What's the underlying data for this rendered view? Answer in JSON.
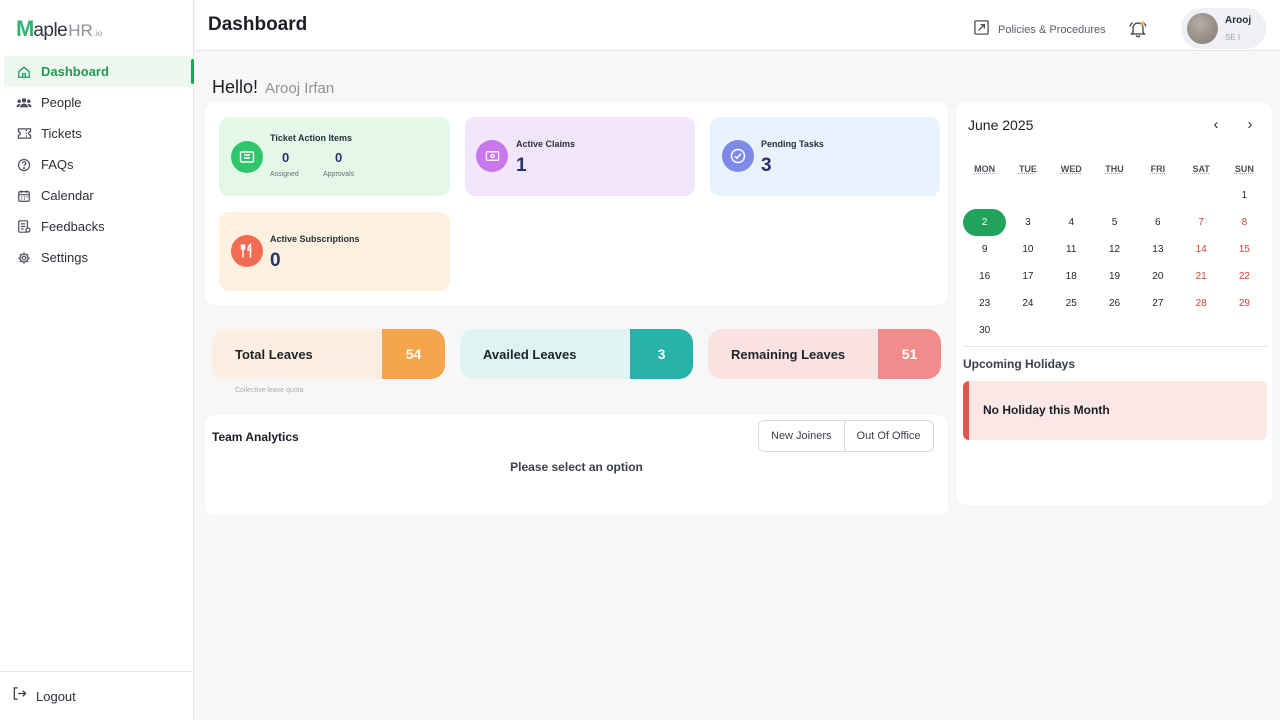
{
  "brand": {
    "logo_m": "M",
    "logo_rest": "aple",
    "logo_hr": "HR",
    "logo_io": ".io"
  },
  "sidebar": {
    "items": [
      {
        "label": "Dashboard",
        "icon": "home-icon",
        "active": true
      },
      {
        "label": "People",
        "icon": "people-icon"
      },
      {
        "label": "Tickets",
        "icon": "ticket-icon"
      },
      {
        "label": "FAQs",
        "icon": "question-icon"
      },
      {
        "label": "Calendar",
        "icon": "calendar-icon"
      },
      {
        "label": "Feedbacks",
        "icon": "feedback-icon"
      },
      {
        "label": "Settings",
        "icon": "gear-icon"
      }
    ],
    "logout_label": "Logout"
  },
  "header": {
    "title": "Dashboard",
    "policies_label": "Policies & Procedures",
    "user": {
      "name": "Arooj",
      "role": "SE I"
    }
  },
  "greeting": {
    "hello": "Hello!",
    "name": "Arooj Irfan"
  },
  "cards": {
    "ticket_actions": {
      "title": "Ticket Action Items",
      "assigned_value": "0",
      "assigned_label": "Assigned",
      "approvals_value": "0",
      "approvals_label": "Approvals"
    },
    "active_claims": {
      "title": "Active Claims",
      "value": "1"
    },
    "pending_tasks": {
      "title": "Pending Tasks",
      "value": "3"
    },
    "active_subscriptions": {
      "title": "Active Subscriptions",
      "value": "0"
    }
  },
  "leaves": {
    "total": {
      "label": "Total Leaves",
      "value": "54"
    },
    "availed": {
      "label": "Availed Leaves",
      "value": "3"
    },
    "remaining": {
      "label": "Remaining Leaves",
      "value": "51"
    },
    "quota_note": "Collective leave quota"
  },
  "team": {
    "title": "Team Analytics",
    "options": [
      "New Joiners",
      "Out Of Office"
    ],
    "message": "Please select an option"
  },
  "calendar": {
    "title": "June 2025",
    "prev": "‹",
    "next": "›",
    "weekdays": [
      "MON",
      "TUE",
      "WED",
      "THU",
      "FRI",
      "SAT",
      "SUN"
    ],
    "weeks": [
      [
        "",
        "",
        "",
        "",
        "",
        "",
        "1"
      ],
      [
        "2",
        "3",
        "4",
        "5",
        "6",
        "7",
        "8"
      ],
      [
        "9",
        "10",
        "11",
        "12",
        "13",
        "14",
        "15"
      ],
      [
        "16",
        "17",
        "18",
        "19",
        "20",
        "21",
        "22"
      ],
      [
        "23",
        "24",
        "25",
        "26",
        "27",
        "28",
        "29"
      ],
      [
        "30",
        "",
        "",
        "",
        "",
        "",
        ""
      ]
    ],
    "today": "2"
  },
  "holidays": {
    "title": "Upcoming Holidays",
    "message": "No Holiday this Month"
  },
  "colors": {
    "accent": "#21a35b",
    "ticket_card": "#e3f8e9",
    "claims_card": "#f1e6fb",
    "tasks_card": "#e9f3fd",
    "subs_card": "#fff1e0",
    "total_leaves_bg": "#fdeee2",
    "total_leaves_val": "#f6a54c",
    "availed_bg": "#dff3f2",
    "availed_val": "#29b3a8",
    "remaining_bg": "#fbe2e2",
    "remaining_val": "#f28c8c",
    "weekend": "#d0423a"
  }
}
